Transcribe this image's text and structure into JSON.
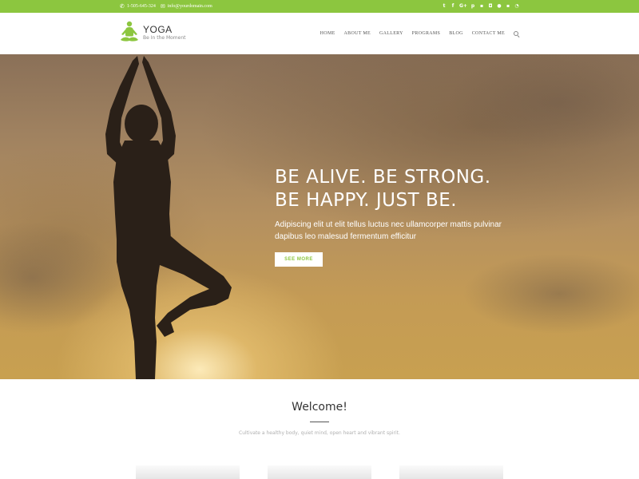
{
  "topbar": {
    "phone": "1-505-645-324",
    "email": "info@yourdomain.com",
    "social_icons": [
      "twitter-icon",
      "facebook-icon",
      "google-plus-icon",
      "pinterest-icon",
      "linkedin-icon",
      "instagram-icon",
      "flickr-icon",
      "vimeo-icon",
      "rss-icon"
    ],
    "background_color": "#8cc63f"
  },
  "header": {
    "logo_title": "YOGA",
    "logo_tagline": "Be In the Moment",
    "nav": [
      "HOME",
      "ABOUT ME",
      "GALLERY",
      "PROGRAMS",
      "BLOG",
      "CONTACT ME"
    ]
  },
  "hero": {
    "headline_line1": "BE ALIVE. BE STRONG.",
    "headline_line2": "BE HAPPY. JUST BE.",
    "subtext_line1": "Adipiscing elit ut elit tellus luctus nec ullamcorper mattis pulvinar",
    "subtext_line2": "dapibus leo malesud fermentum efficitur",
    "button_label": "SEE MORE"
  },
  "welcome": {
    "title": "Welcome!",
    "subtitle": "Cultivate a healthy body, quiet mind, open heart and vibrant spirit."
  },
  "colors": {
    "accent": "#8cc63f",
    "text_dark": "#333333",
    "text_muted": "#b0b0b0"
  }
}
